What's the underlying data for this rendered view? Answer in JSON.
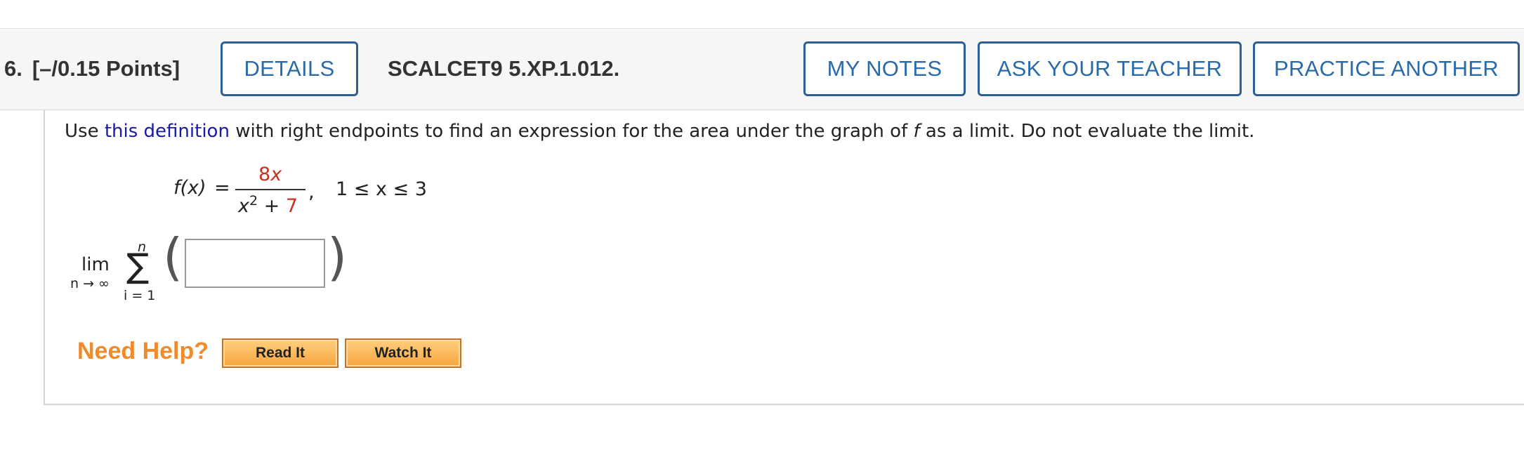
{
  "question": {
    "number": "6.",
    "points": "[–/0.15 Points]",
    "id": "SCALCET9 5.XP.1.012."
  },
  "buttons": {
    "details": "DETAILS",
    "my_notes": "MY NOTES",
    "ask_teacher": "ASK YOUR TEACHER",
    "practice_another": "PRACTICE ANOTHER"
  },
  "instructions": {
    "before_link": "Use ",
    "link_text": "this definition",
    "after_link": " with right endpoints to find an expression for the area under the graph of ",
    "variable": "f",
    "end": " as a limit. Do not evaluate the limit."
  },
  "function": {
    "lhs": "f(x)",
    "equals": "=",
    "numerator_coef": "8",
    "numerator_var": "x",
    "denominator_var": "x",
    "denominator_exp": "2",
    "denominator_plus": " + ",
    "denominator_const": "7",
    "comma": ",",
    "domain": "1 ≤ x ≤ 3"
  },
  "limit": {
    "lim": "lim",
    "sub": "n → ∞",
    "sum_top": "n",
    "sigma": "∑",
    "sum_bottom": "i = 1",
    "left_paren": "(",
    "right_paren": ")",
    "answer_value": ""
  },
  "help": {
    "label": "Need Help?",
    "read_it": "Read It",
    "watch_it": "Watch It"
  },
  "colors": {
    "button_border": "#2c5f97",
    "button_text": "#2a6aa8",
    "link": "#1a1aa6",
    "highlight_red": "#c8321e",
    "need_help_orange": "#ee8b2c"
  }
}
